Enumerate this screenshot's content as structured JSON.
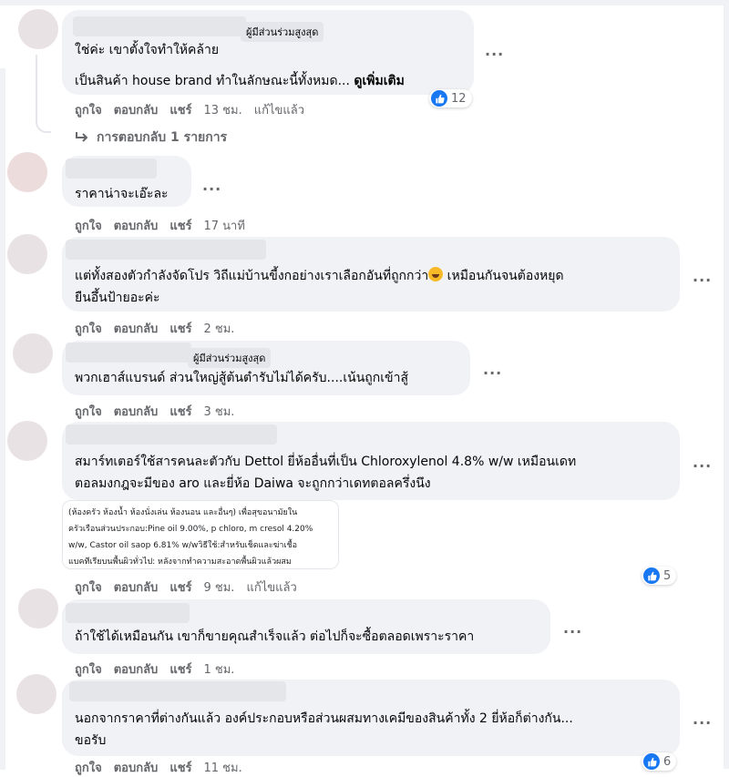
{
  "comments": [
    {
      "badge": "ผู้มีส่วนร่วมสูงสุด",
      "line1": "ใช่ค่ะ เขาตั้งใจทำให้คล้าย",
      "line2": "เป็นสินค้า house brand ทำในลักษณะนี้ทั้งหมด... ",
      "see_more": "ดูเพิ่มเติม",
      "actions": {
        "like": "ถูกใจ",
        "reply": "ตอบกลับ",
        "share": "แชร์",
        "time": "13 ชม.",
        "edited": "แก้ไขแล้ว"
      },
      "reaction_count": "12",
      "reply_summary": "การตอบกลับ 1 รายการ"
    },
    {
      "text": "ราคาน่าจะเอ๊ะละ",
      "actions": {
        "like": "ถูกใจ",
        "reply": "ตอบกลับ",
        "share": "แชร์",
        "time": "17 นาที"
      }
    },
    {
      "text_a": "แต่ทั้งสองตัวกำลังจัดโปร วิถีแม่บ้านขี้งกอย่างเราเลือกอันที่ถูกกว่า",
      "text_b": " เหมือนกันจนต้องหยุด",
      "text_c": "ยืนอึ้นป้ายอะค่ะ",
      "actions": {
        "like": "ถูกใจ",
        "reply": "ตอบกลับ",
        "share": "แชร์",
        "time": "2 ชม."
      }
    },
    {
      "badge": "ผู้มีส่วนร่วมสูงสุด",
      "text": "พวกเฮาส์แบรนด์ ส่วนใหญ่สู้ต้นตำรับไม่ได้ครับ....เน้นถูกเข้าสู้",
      "actions": {
        "like": "ถูกใจ",
        "reply": "ตอบกลับ",
        "share": "แชร์",
        "time": "3 ชม."
      }
    },
    {
      "line1": "สมาร์ทเตอร์ใช้สารคนละตัวกับ Dettol ยี่ห้ออื่นที่เป็น Chloroxylenol 4.8% w/w เหมือนเดท",
      "line2": "ตอลมงกฎจะมีของ aro และยี่ห้อ Daiwa จะถูกกว่าเดทตอลครึ่งนึง",
      "attachment_lines": [
        "(ห้องครัว ห้องน้ำ ห้องนั่งเล่น ห้องนอน และอื่นๆ) เพื่อสุขอนามัยใน",
        "ครัวเรือนส่วนประกอบ:Pine oil 9.00%, p chloro, m cresol 4.20%",
        "w/w, Castor oil saop 6.81% w/wวิธีใช้:สำหรับเช็ดและฆ่าเชื้อ",
        "แบคทีเรียบนพื้นผิวทั่วไป: หลังจากทำความสะอาดพื้นผิวแล้วผสม"
      ],
      "actions": {
        "like": "ถูกใจ",
        "reply": "ตอบกลับ",
        "share": "แชร์",
        "time": "9 ชม.",
        "edited": "แก้ไขแล้ว"
      },
      "reaction_count": "5"
    },
    {
      "text": "ถ้าใช้ได้เหมือนกัน เขาก็ขายคุณสำเร็จแล้ว ต่อไปก็จะซื้อตลอดเพราะราคา",
      "actions": {
        "like": "ถูกใจ",
        "reply": "ตอบกลับ",
        "share": "แชร์",
        "time": "1 ชม."
      }
    },
    {
      "line1": "นอกจากราคาที่ต่างกันแล้ว องค์ประกอบหรือส่วนผสมทางเคมีของสินค้าทั้ง 2 ยี่ห้อก็ต่างกัน...",
      "line2": "ขอรับ",
      "actions": {
        "like": "ถูกใจ",
        "reply": "ตอบกลับ",
        "share": "แชร์",
        "time": "11 ชม."
      },
      "reaction_count": "6"
    }
  ],
  "more_options": "...",
  "colors": {
    "like_blue": "#1877f2",
    "bubble": "#f0f2f5",
    "meta_gray": "#65676b"
  }
}
